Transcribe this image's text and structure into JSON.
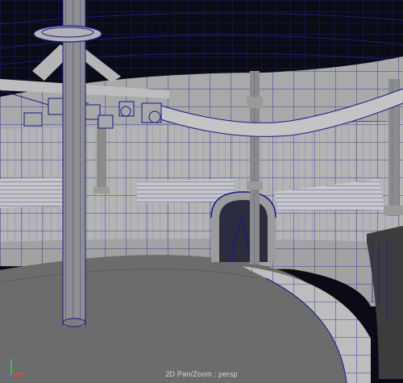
{
  "viewport": {
    "hud_label": "2D Pan/Zoom : persp",
    "camera": "persp"
  },
  "axis_gizmo": {
    "x_color": "#ff3b3b",
    "y_color": "#37d637",
    "z_color": "#3b7bff"
  },
  "colors": {
    "background": "#0b0b16",
    "wireframe": "#151a8c",
    "wall_shade": "#b8b8b8",
    "floor_shade": "#6c6c6c"
  }
}
